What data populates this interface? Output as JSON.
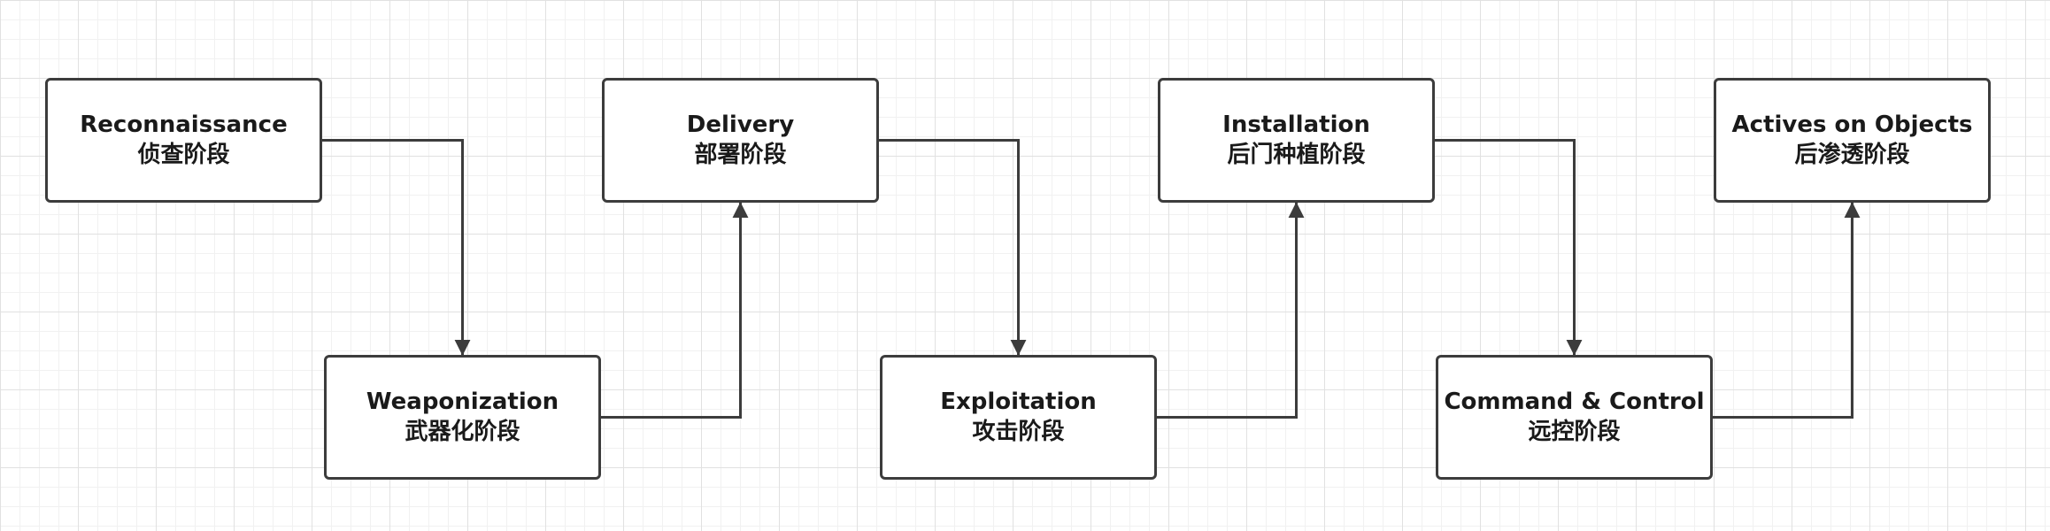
{
  "diagram": {
    "nodes": [
      {
        "id": "recon",
        "en": "Reconnaissance",
        "zh": "侦查阶段"
      },
      {
        "id": "weapon",
        "en": "Weaponization",
        "zh": "武器化阶段"
      },
      {
        "id": "delivery",
        "en": "Delivery",
        "zh": "部署阶段"
      },
      {
        "id": "exploit",
        "en": "Exploitation",
        "zh": "攻击阶段"
      },
      {
        "id": "install",
        "en": "Installation",
        "zh": "后门种植阶段"
      },
      {
        "id": "c2",
        "en": "Command & Control",
        "zh": "远控阶段"
      },
      {
        "id": "actions",
        "en": "Actives on Objects",
        "zh": "后渗透阶段"
      }
    ],
    "edges": [
      {
        "from": "recon",
        "to": "weapon"
      },
      {
        "from": "weapon",
        "to": "delivery"
      },
      {
        "from": "delivery",
        "to": "exploit"
      },
      {
        "from": "exploit",
        "to": "install"
      },
      {
        "from": "install",
        "to": "c2"
      },
      {
        "from": "c2",
        "to": "actions"
      }
    ],
    "colors": {
      "stroke": "#3c3c3c",
      "text": "#1a1a1a"
    }
  }
}
